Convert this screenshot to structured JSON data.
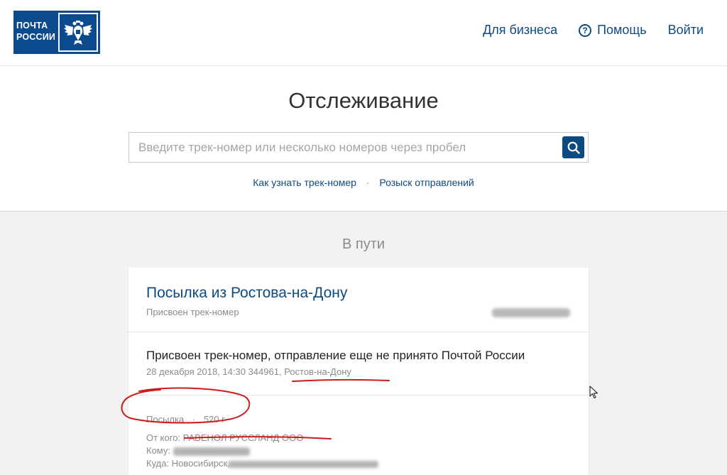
{
  "header": {
    "logo_line1": "ПОЧТА",
    "logo_line2": "РОССИИ",
    "nav": {
      "business": "Для бизнеса",
      "help": "Помощь",
      "login": "Войти"
    }
  },
  "tracking": {
    "title": "Отслеживание",
    "search_placeholder": "Введите трек-номер или несколько номеров через пробел",
    "search_value": "",
    "links": {
      "how_to_find": "Как узнать трек-номер",
      "separator": "·",
      "search_lost": "Розыск отправлений"
    }
  },
  "results": {
    "status_heading": "В пути",
    "card": {
      "title": "Посылка из Ростова-на-Дону",
      "subtitle": "Присвоен трек-номер",
      "event": {
        "title": "Присвоен трек-номер, отправление еще не принято Почтой России",
        "datetime_index": "28 декабря 2018, 14:30 344961,",
        "city": "Ростов-на-Дону"
      },
      "details": {
        "type": "Посылка",
        "dot": "·",
        "weight": "520 г",
        "from_label": "От кого:",
        "from_value": "РАВЕНОЛ РУССЛАНД ООО",
        "to_label": "Кому:",
        "where_label": "Куда:",
        "where_value": "Новосибирск,"
      }
    }
  },
  "colors": {
    "brand_blue": "#0b4a8c",
    "link_blue": "#0d4a82",
    "annotation_red": "#d11a1a"
  }
}
